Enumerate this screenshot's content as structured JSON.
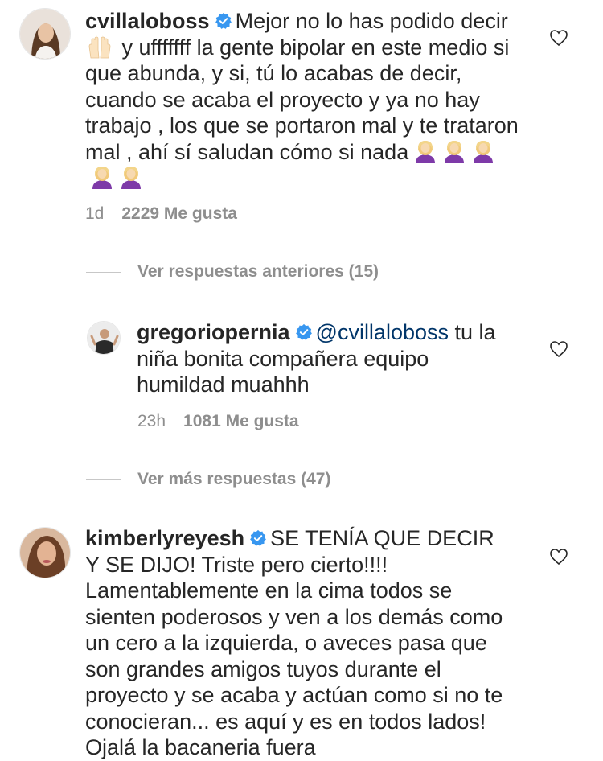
{
  "comments": [
    {
      "username": "cvillaloboss",
      "text_a": "Mejor no lo has podido",
      "text_b": "decir",
      "text_c": " y ufffffff la gente bipolar en este medio si que abunda, y si, tú lo acabas de decir, cuando se acaba el proyecto y ya no hay trabajo , los que se portaron mal y te trataron mal , ahí sí saludan cómo si nada",
      "time": "1d",
      "likes": "2229 Me gusta",
      "emoji_inline": "raising-hands-icon",
      "emoji_trailing": "woman-facepalming-icon"
    },
    {
      "username": "gregoriopernia",
      "mention": "@cvillaloboss",
      "text": " tu la niña bonita compañera equipo humildad muahhh",
      "time": "23h",
      "likes": "1081 Me gusta"
    },
    {
      "username": "kimberlyreyesh",
      "text": "SE TENÍA QUE DECIR Y SE DIJO! Triste pero cierto!!!! Lamentablemente en la cima todos se sienten poderosos y ven a los demás como un cero a la izquierda, o aveces pasa que son grandes amigos tuyos durante el proyecto y se acaba y actúan como si no te conocieran... es aquí y es en todos lados! Ojalá la bacaneria fuera"
    }
  ],
  "view_previous_replies": "Ver respuestas anteriores (15)",
  "view_more_replies": "Ver más respuestas (47)",
  "colors": {
    "text": "#262626",
    "secondary": "#8e8e8e",
    "verified": "#3897f0",
    "mention": "#003569"
  }
}
